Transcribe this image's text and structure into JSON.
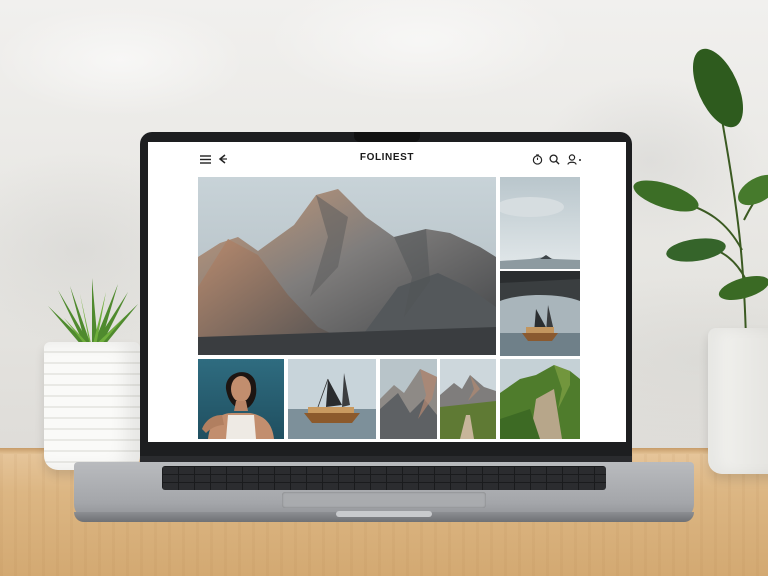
{
  "app": {
    "title": "FOLINEST"
  },
  "header": {
    "icons": [
      "menu-icon",
      "back-arrow-icon",
      "timer-icon",
      "search-icon",
      "profile-icon"
    ]
  },
  "gallery": {
    "photos": [
      {
        "subject": "mountain-peak",
        "role": "featured"
      },
      {
        "subject": "cloudy-sky-coast"
      },
      {
        "subject": "rock-arch-sailboat"
      },
      {
        "subject": "woman-portrait"
      },
      {
        "subject": "sailboat"
      },
      {
        "subject": "rocky-mountain"
      },
      {
        "subject": "mountain-trail-valley"
      },
      {
        "subject": "green-mountain-cliff"
      }
    ]
  },
  "colors": {
    "screen_bg": "#ffffff",
    "bezel": "#1d1e20",
    "title_text": "#1a1a1a"
  }
}
